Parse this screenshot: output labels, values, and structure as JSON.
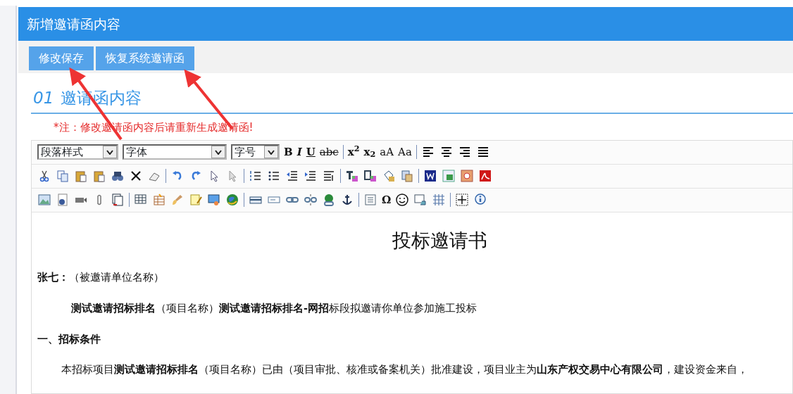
{
  "dialog": {
    "title": "新增邀请函内容"
  },
  "buttons": [
    "修改保存",
    "恢复系统邀请函"
  ],
  "section": {
    "number": "01",
    "title": "邀请函内容"
  },
  "note": "*注：修改邀请函内容后请重新生成邀请函!",
  "toolbar": {
    "selects": [
      "段落样式",
      "字体",
      "字号"
    ],
    "glyphs": [
      "B",
      "I",
      "U",
      "abc",
      "x$^{2}$",
      "x$_{2}$",
      "aA",
      "Aa",
      "Ω"
    ]
  },
  "document": {
    "title": "投标邀请书",
    "paragraphs": [
      {
        "kind": "plain",
        "text": "**张七：**（被邀请单位名称）"
      },
      {
        "kind": "indented",
        "text": "**测试邀请招标排名**（项目名称）**测试邀请招标排名-网招**标段拟邀请你单位参加施工投标"
      },
      {
        "kind": "heading",
        "text": "一、招标条件"
      },
      {
        "kind": "indented",
        "text": "本招标项目**测试邀请招标排名**（项目名称）已由（项目审批、核准或备案机关）批准建设，项目业主为**山东产权交易中心有限公司**，建设资金来自，"
      }
    ]
  }
}
